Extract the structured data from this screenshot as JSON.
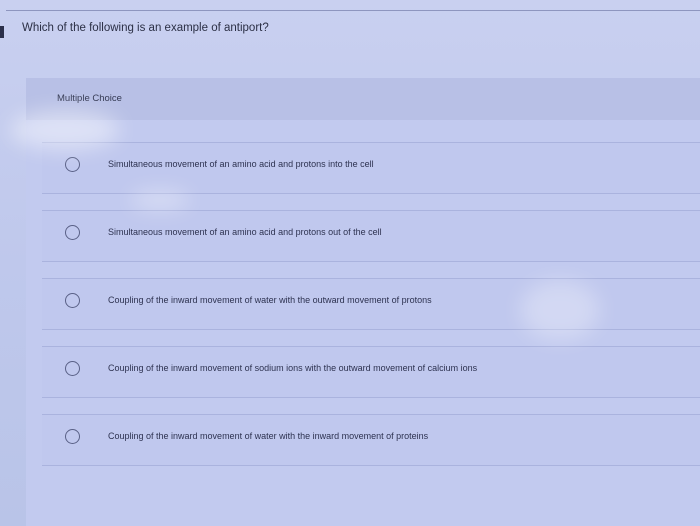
{
  "question": {
    "text": "Which of the following is an example of antiport?"
  },
  "choices": {
    "type_label": "Multiple Choice",
    "options": [
      {
        "label": "Simultaneous movement of an amino acid and protons into the cell"
      },
      {
        "label": "Simultaneous movement of an amino acid and protons out of the cell"
      },
      {
        "label": "Coupling of the inward movement of water with the outward movement of protons"
      },
      {
        "label": "Coupling of the inward movement of sodium ions with the outward movement of calcium ions"
      },
      {
        "label": "Coupling of the inward movement of water with the inward movement of proteins"
      }
    ]
  },
  "colors": {
    "background": "#c3cde9",
    "panel": "#c2caef",
    "text": "#2b2f45",
    "radio_border": "#5a6187"
  }
}
